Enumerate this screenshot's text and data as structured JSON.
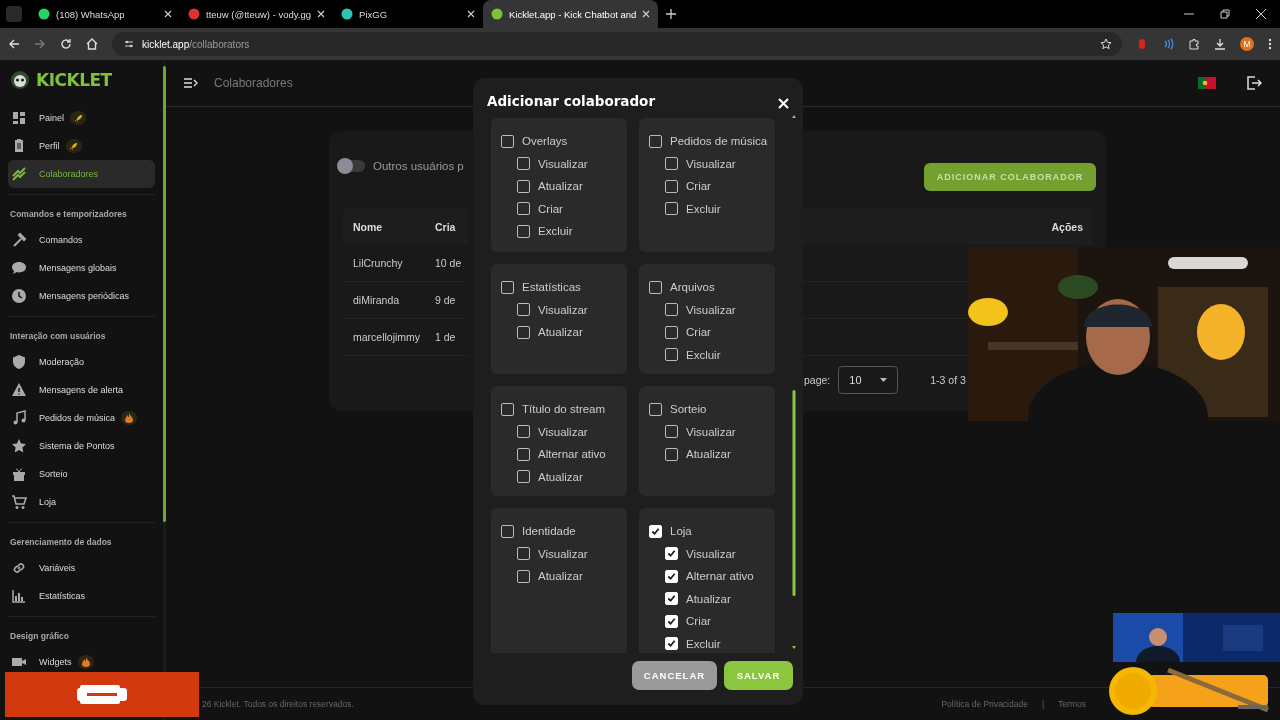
{
  "browser": {
    "tabs": [
      {
        "title": "(108) WhatsApp",
        "selected": false
      },
      {
        "title": "tteuw (@tteuw) - vody.gg",
        "selected": false
      },
      {
        "title": "PixGG",
        "selected": false
      },
      {
        "title": "Kicklet.app - Kick Chatbot and",
        "selected": true
      }
    ],
    "url_host": "kicklet.app",
    "url_path": "/collaborators",
    "profile": "M"
  },
  "sidebar": {
    "logo": "KICKLET",
    "groups": [
      {
        "items": [
          {
            "label": "Painel",
            "kind": "rocket",
            "selected": false
          },
          {
            "label": "Perfil",
            "kind": "rocket",
            "selected": false
          },
          {
            "label": "Colaboradores",
            "kind": "plain",
            "selected": true
          }
        ]
      },
      {
        "heading": "Comandos e temporizadores",
        "items": [
          {
            "label": "Comandos",
            "kind": "plain",
            "selected": false
          },
          {
            "label": "Mensagens globais",
            "kind": "plain",
            "selected": false
          },
          {
            "label": "Mensagens periódicas",
            "kind": "plain",
            "selected": false
          }
        ]
      },
      {
        "heading": "Interação com usuários",
        "items": [
          {
            "label": "Moderação",
            "kind": "plain",
            "selected": false
          },
          {
            "label": "Mensagens de alerta",
            "kind": "plain",
            "selected": false
          },
          {
            "label": "Pedidos de música",
            "kind": "fire",
            "selected": false
          },
          {
            "label": "Sistema de Pontos",
            "kind": "plain",
            "selected": false
          },
          {
            "label": "Sorteio",
            "kind": "plain",
            "selected": false
          },
          {
            "label": "Loja",
            "kind": "plain",
            "selected": false
          }
        ]
      },
      {
        "heading": "Gerenciamento de dados",
        "items": [
          {
            "label": "Variáveis",
            "kind": "plain",
            "selected": false
          },
          {
            "label": "Estatísticas",
            "kind": "plain",
            "selected": false
          }
        ]
      },
      {
        "heading": "Design gráfico",
        "items": [
          {
            "label": "Widgets",
            "kind": "fire",
            "selected": false
          }
        ]
      }
    ]
  },
  "header": {
    "title": "Colaboradores"
  },
  "main": {
    "toggle": {
      "label": "Outros usuários p",
      "on": false
    },
    "add_button": "ADICIONAR COLABORADOR",
    "table": {
      "columns": [
        "Nome",
        "Cria",
        "Ações"
      ],
      "rows": [
        [
          "LilCrunchy",
          "10 de"
        ],
        [
          "diMiranda",
          "9 de"
        ],
        [
          "marcellojimmy",
          "1 de"
        ]
      ]
    },
    "pagination": {
      "label": "page:",
      "per_page": "10",
      "range": "1-3 of 3"
    }
  },
  "dialog": {
    "title": "Adicionar colaborador",
    "groups": [
      {
        "label": "Overlays",
        "checked": false,
        "children": [
          {
            "label": "Visualizar",
            "checked": false
          },
          {
            "label": "Atualizar",
            "checked": false
          },
          {
            "label": "Criar",
            "checked": false
          },
          {
            "label": "Excluir",
            "checked": false
          }
        ]
      },
      {
        "label": "Pedidos de música",
        "checked": false,
        "children": [
          {
            "label": "Visualizar",
            "checked": false
          },
          {
            "label": "Criar",
            "checked": false
          },
          {
            "label": "Excluir",
            "checked": false
          }
        ]
      },
      {
        "label": "Estatísticas",
        "checked": false,
        "children": [
          {
            "label": "Visualizar",
            "checked": false
          },
          {
            "label": "Atualizar",
            "checked": false
          }
        ]
      },
      {
        "label": "Arquivos",
        "checked": false,
        "children": [
          {
            "label": "Visualizar",
            "checked": false
          },
          {
            "label": "Criar",
            "checked": false
          },
          {
            "label": "Excluir",
            "checked": false
          }
        ]
      },
      {
        "label": "Título do stream",
        "checked": false,
        "children": [
          {
            "label": "Visualizar",
            "checked": false
          },
          {
            "label": "Alternar ativo",
            "checked": false
          },
          {
            "label": "Atualizar",
            "checked": false
          }
        ]
      },
      {
        "label": "Sorteio",
        "checked": false,
        "children": [
          {
            "label": "Visualizar",
            "checked": false
          },
          {
            "label": "Atualizar",
            "checked": false
          }
        ]
      },
      {
        "label": "Identidade",
        "checked": false,
        "children": [
          {
            "label": "Visualizar",
            "checked": false
          },
          {
            "label": "Atualizar",
            "checked": false
          }
        ]
      },
      {
        "label": "Loja",
        "checked": true,
        "children": [
          {
            "label": "Visualizar",
            "checked": true
          },
          {
            "label": "Alternar ativo",
            "checked": true
          },
          {
            "label": "Atualizar",
            "checked": true
          },
          {
            "label": "Criar",
            "checked": true
          },
          {
            "label": "Excluir",
            "checked": true
          }
        ]
      }
    ],
    "buttons": [
      "CANCELAR",
      "SALVAR"
    ]
  },
  "footer": {
    "copyright": "26 Kicklet. Todos os direitos reservados.",
    "links": [
      "Política de Privacidade",
      "|",
      "Termos"
    ]
  }
}
